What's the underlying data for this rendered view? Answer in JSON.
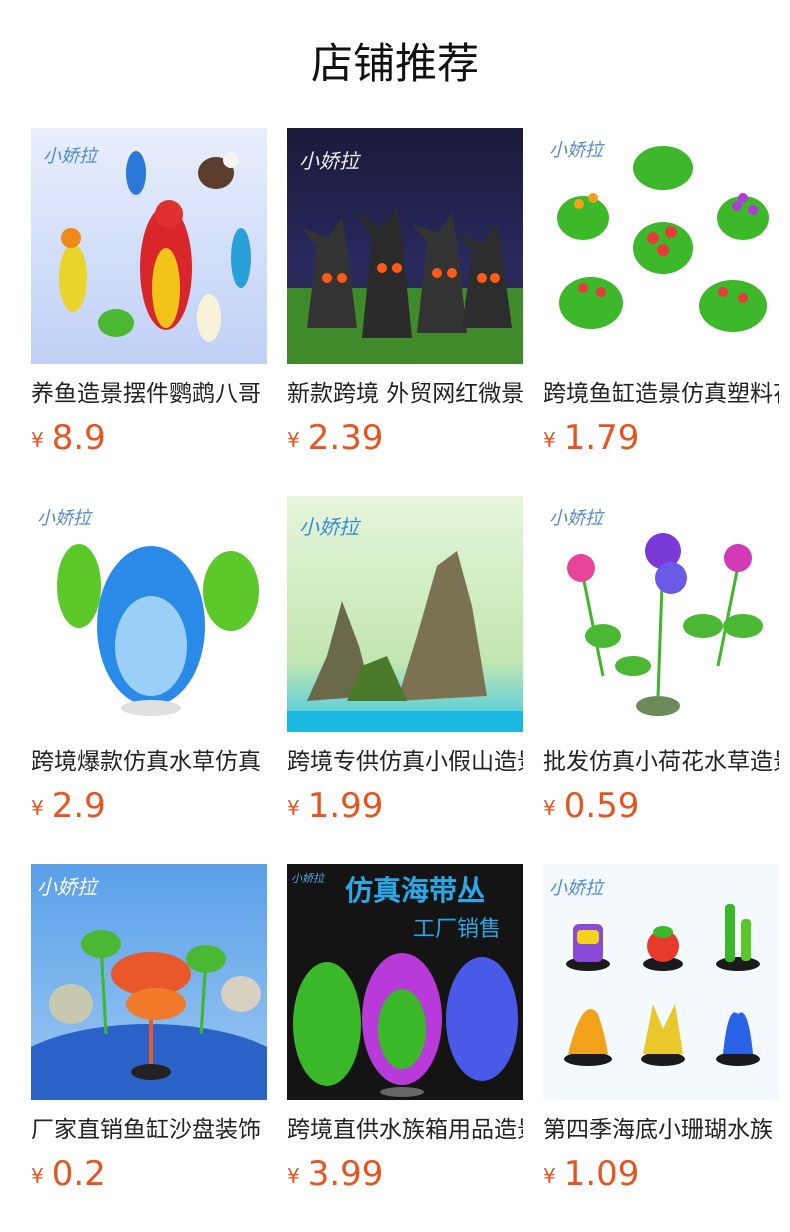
{
  "page": {
    "title": "店铺推荐",
    "currency_symbol": "¥",
    "price_color": "#e8541e"
  },
  "products": [
    {
      "name": "养鱼造景摆件鹦鹉八哥",
      "price": "8.9",
      "brand": "小娇拉",
      "image": "parrot-figurines"
    },
    {
      "name": "新款跨境 外贸网红微景观",
      "price": "2.39",
      "brand": "小娇拉",
      "image": "spooky-tree-ornaments"
    },
    {
      "name": "跨境鱼缸造景仿真塑料花",
      "price": "1.79",
      "brand": "小娇拉",
      "image": "artificial-flower-plants"
    },
    {
      "name": "跨境爆款仿真水草仿真",
      "price": "2.9",
      "brand": "小娇拉",
      "image": "blue-water-plant"
    },
    {
      "name": "跨境专供仿真小假山造景",
      "price": "1.99",
      "brand": "小娇拉",
      "image": "rockery-mountain"
    },
    {
      "name": "批发仿真小荷花水草造景",
      "price": "0.59",
      "brand": "小娇拉",
      "image": "lotus-plants"
    },
    {
      "name": "厂家直销鱼缸沙盘装饰",
      "price": "0.2",
      "brand": "小娇拉",
      "image": "palm-tree-plants"
    },
    {
      "name": "跨境直供水族箱用品造景",
      "price": "3.99",
      "brand": "小娇拉",
      "banner_title": "仿真海带丛",
      "banner_subtitle": "工厂销售",
      "image": "kelp-bushes"
    },
    {
      "name": "第四季海底小珊瑚水族",
      "price": "1.09",
      "brand": "小娇拉",
      "image": "coral-ornaments"
    }
  ]
}
